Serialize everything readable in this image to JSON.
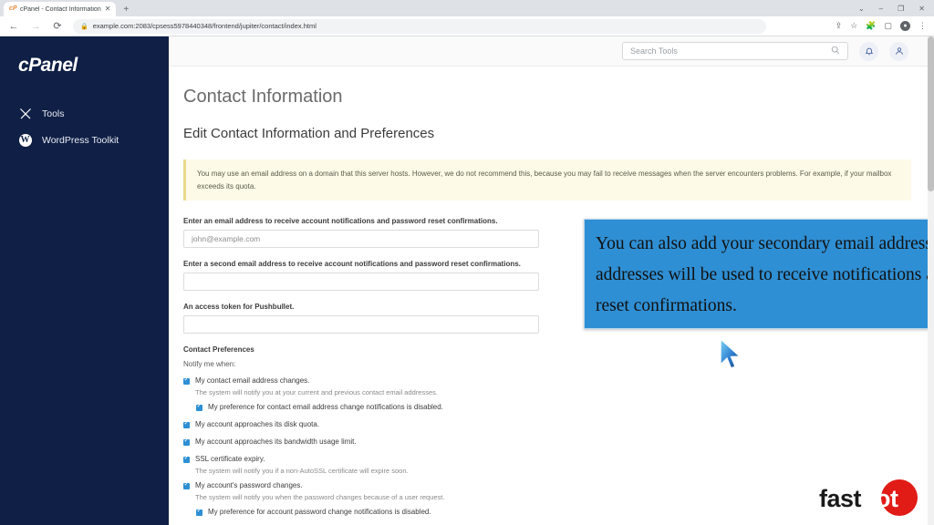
{
  "browser": {
    "tab": {
      "title": "cPanel - Contact Information",
      "favicon": "cpanel-favicon",
      "close_label": "✕"
    },
    "new_tab_label": "+",
    "window_controls": {
      "collapse": "⌄",
      "minimize": "–",
      "maximize": "❐",
      "close": "✕"
    },
    "nav": {
      "back": "←",
      "forward": "→",
      "reload": "⟳"
    },
    "address": {
      "lock_icon": "lock-icon",
      "url": "example.com:2083/cpsess5978440348/frontend/jupiter/contact/index.html"
    },
    "toolbar_icons": [
      "share-icon",
      "bookmark-star-icon",
      "extensions-icon",
      "sidepanel-icon",
      "profile-icon",
      "menu-icon"
    ]
  },
  "sidebar": {
    "brand": "cPanel",
    "items": [
      {
        "label": "Tools",
        "icon": "tools-icon"
      },
      {
        "label": "WordPress Toolkit",
        "icon": "wordpress-icon"
      }
    ]
  },
  "topbar": {
    "search": {
      "placeholder": "Search Tools",
      "value": "",
      "icon": "search-icon"
    },
    "notifications_icon": "bell-icon",
    "account_icon": "user-icon"
  },
  "page": {
    "title": "Contact Information",
    "section_title": "Edit Contact Information and Preferences",
    "alert": "You may use an email address on a domain that this server hosts. However, we do not recommend this, because you may fail to receive messages when the server encounters problems. For example, if your mailbox exceeds its quota.",
    "fields": [
      {
        "label": "Enter an email address to receive account notifications and password reset confirmations.",
        "value": "",
        "placeholder": "john@example.com"
      },
      {
        "label": "Enter a second email address to receive account notifications and password reset confirmations.",
        "value": "",
        "placeholder": ""
      },
      {
        "label": "An access token for Pushbullet.",
        "value": "",
        "placeholder": ""
      }
    ],
    "preferences_title": "Contact Preferences",
    "notify_label": "Notify me when:",
    "preferences": [
      {
        "label": "My contact email address changes.",
        "checked": true,
        "help": "The system will notify you at your current and previous contact email addresses.",
        "sub": {
          "label": "My preference for contact email address change notifications is disabled.",
          "checked": true
        }
      },
      {
        "label": "My account approaches its disk quota.",
        "checked": true,
        "help": "",
        "sub": null
      },
      {
        "label": "My account approaches its bandwidth usage limit.",
        "checked": true,
        "help": "",
        "sub": null
      },
      {
        "label": "SSL certificate expiry.",
        "checked": true,
        "help": "The system will notify you if a non-AutoSSL certificate will expire soon.",
        "sub": null
      },
      {
        "label": "My account's password changes.",
        "checked": true,
        "help": "The system will notify you when the password changes because of a user request.",
        "sub": {
          "label": "My preference for account password change notifications is disabled.",
          "checked": true
        }
      }
    ]
  },
  "callout": {
    "text": "You can also add your secondary email address. These email addresses will be used to receive notifications and password reset confirmations.",
    "background": "#2f8fd4"
  },
  "logo": {
    "text_light": "fast",
    "text_dot": "dot",
    "circle_color": "#e11b16"
  },
  "colors": {
    "sidebar": "#0f1f45",
    "accent": "#2d8fd5",
    "alert_bg": "#fdfae8"
  }
}
